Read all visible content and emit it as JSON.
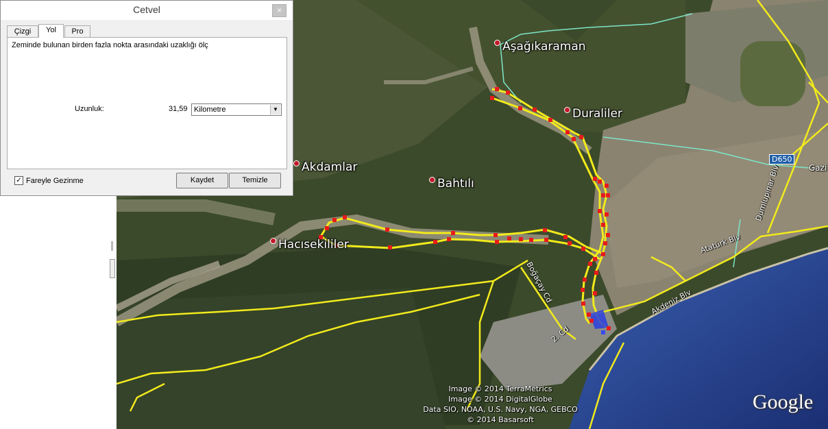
{
  "dialog": {
    "title": "Cetvel",
    "close_label": "×",
    "tabs": [
      {
        "label": "Çizgi",
        "active": false
      },
      {
        "label": "Yol",
        "active": true
      },
      {
        "label": "Pro",
        "active": false
      }
    ],
    "description": "Zeminde bulunan birden fazla nokta arasındaki uzaklığı ölç",
    "length_label": "Uzunluk:",
    "length_value": "31,59",
    "unit_selected": "Kilometre",
    "mouse_navigation": {
      "label": "Fareyle Gezinme",
      "checked": true,
      "mark": "✓"
    },
    "buttons": {
      "save": "Kaydet",
      "clear": "Temizle"
    }
  },
  "map": {
    "places": [
      "Aşağıkaraman",
      "Duraliler",
      "Akdamlar",
      "Bahtılı",
      "Hacısekililer"
    ],
    "roads": [
      "Boğaçay Cd",
      "2. Cd",
      "Akdeniz Blv",
      "Atatürk Blv",
      "Dumlupınar Blv"
    ],
    "highway_shield": "D650",
    "edge_label": "Gazi",
    "attribution": [
      "Image © 2014 TerraMetrics",
      "Image © 2014 DigitalGlobe",
      "Data SIO, NOAA, U.S. Navy, NGA, GEBCO",
      "© 2014 Basarsoft"
    ],
    "logo": "Google",
    "colors": {
      "path": "#f2ea1c",
      "vertex": "#e81b1b",
      "end_marker": "#2a3ee0",
      "boundary": "#7de6c8"
    }
  }
}
